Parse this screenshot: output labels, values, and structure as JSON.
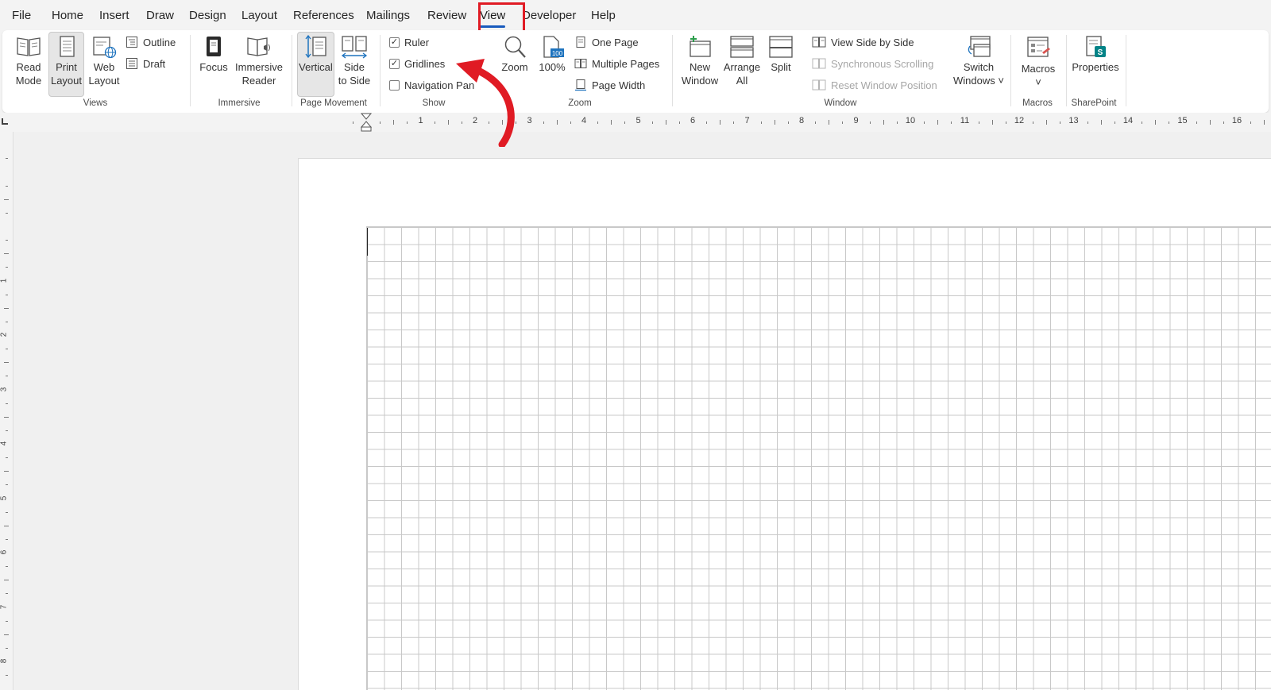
{
  "menu": {
    "tabs": [
      "File",
      "Home",
      "Insert",
      "Draw",
      "Design",
      "Layout",
      "References",
      "Mailings",
      "Review",
      "View",
      "Developer",
      "Help"
    ],
    "active_tab": "View"
  },
  "ribbon": {
    "views": {
      "group_label": "Views",
      "read_mode": [
        "Read",
        "Mode"
      ],
      "print_layout": [
        "Print",
        "Layout"
      ],
      "web_layout": [
        "Web",
        "Layout"
      ],
      "outline": "Outline",
      "draft": "Draft"
    },
    "immersive": {
      "group_label": "Immersive",
      "focus": "Focus",
      "immersive_reader": [
        "Immersive",
        "Reader"
      ]
    },
    "page_movement": {
      "group_label": "Page Movement",
      "vertical": "Vertical",
      "side_to_side": [
        "Side",
        "to Side"
      ]
    },
    "show": {
      "group_label": "Show",
      "ruler": "Ruler",
      "gridlines": "Gridlines",
      "navigation_pane": "Navigation Pan"
    },
    "zoom": {
      "group_label": "Zoom",
      "zoom": "Zoom",
      "hundred": "100%",
      "one_page": "One Page",
      "multiple_pages": "Multiple Pages",
      "page_width": "Page Width"
    },
    "window": {
      "group_label": "Window",
      "new_window": [
        "New",
        "Window"
      ],
      "arrange_all": [
        "Arrange",
        "All"
      ],
      "split": "Split",
      "view_side_by_side": "View Side by Side",
      "synchronous_scrolling": "Synchronous Scrolling",
      "reset_window_position": "Reset Window Position",
      "switch_windows": [
        "Switch",
        "Windows ˅"
      ]
    },
    "macros": {
      "group_label": "Macros",
      "macros": "Macros",
      "macros_caret": "˅"
    },
    "sharepoint": {
      "group_label": "SharePoint",
      "properties": "Properties"
    }
  },
  "ruler": {
    "h_numbers": [
      "1",
      "2",
      "3",
      "4",
      "5",
      "6",
      "7",
      "8",
      "9",
      "10",
      "11",
      "12",
      "13",
      "14",
      "15",
      "16"
    ],
    "v_numbers": [
      "1",
      "2",
      "3",
      "4",
      "5",
      "6",
      "7",
      "8"
    ]
  },
  "colors": {
    "highlight": "#e01b24",
    "arrow": "#e01b24",
    "accent": "#185abd"
  }
}
